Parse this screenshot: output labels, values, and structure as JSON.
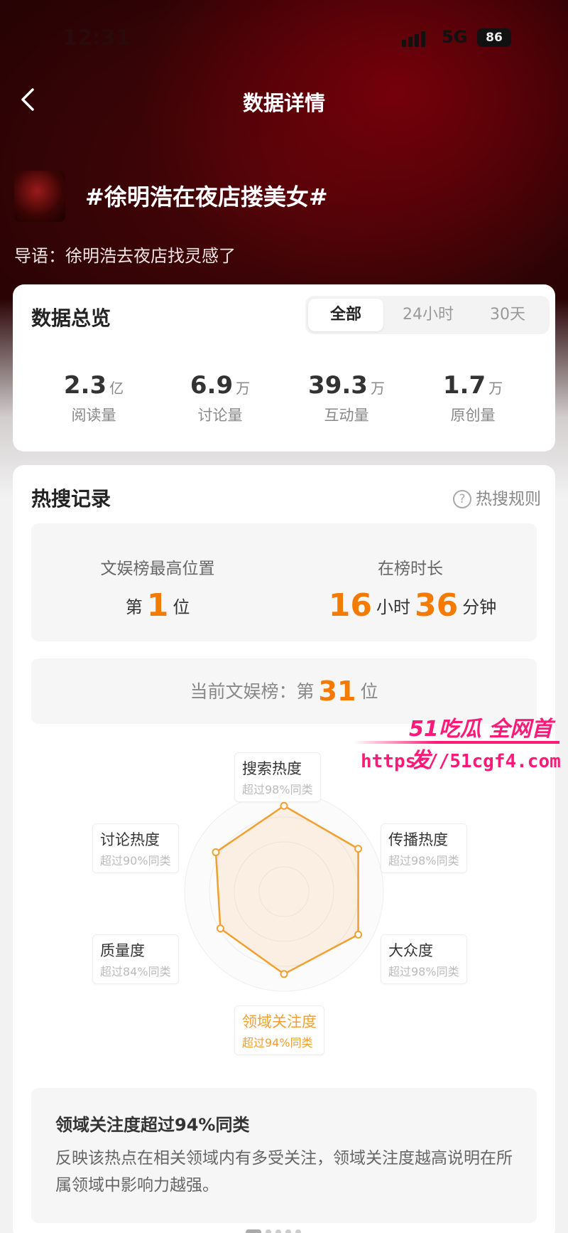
{
  "status_bar": {
    "time": "12:31",
    "network": "5G",
    "battery": "86"
  },
  "nav": {
    "title": "数据详情"
  },
  "topic": {
    "title": "#徐明浩在夜店搂美女#",
    "intro": "导语：徐明浩去夜店找灵感了"
  },
  "overview": {
    "title": "数据总览",
    "tabs": [
      "全部",
      "24小时",
      "30天"
    ],
    "active_tab": "全部",
    "stats": [
      {
        "value": "2.3",
        "unit": "亿",
        "label": "阅读量"
      },
      {
        "value": "6.9",
        "unit": "万",
        "label": "讨论量"
      },
      {
        "value": "39.3",
        "unit": "万",
        "label": "互动量"
      },
      {
        "value": "1.7",
        "unit": "万",
        "label": "原创量"
      }
    ]
  },
  "hot_search": {
    "title": "热搜记录",
    "rules_link": "热搜规则",
    "peak_label": "文娱榜最高位置",
    "peak_prefix": "第",
    "peak_value": "1",
    "peak_suffix": "位",
    "duration_label": "在榜时长",
    "duration_hours": "16",
    "duration_hours_unit": "小时",
    "duration_minutes": "36",
    "duration_minutes_unit": "分钟",
    "current_prefix": "当前文娱榜：第",
    "current_value": "31",
    "current_suffix": "位"
  },
  "radar": {
    "highlight_color": "#f0a030",
    "axes": [
      {
        "name": "搜索热度",
        "sub": "超过98%同类",
        "percent": 98
      },
      {
        "name": "传播热度",
        "sub": "超过98%同类",
        "percent": 98
      },
      {
        "name": "大众度",
        "sub": "超过98%同类",
        "percent": 98
      },
      {
        "name": "领域关注度",
        "sub": "超过94%同类",
        "percent": 94
      },
      {
        "name": "质量度",
        "sub": "超过84%同类",
        "percent": 84
      },
      {
        "name": "讨论热度",
        "sub": "超过90%同类",
        "percent": 90
      }
    ]
  },
  "description": {
    "title": "领域关注度超过94%同类",
    "text": "反映该热点在相关领域内有多受关注，领域关注度越高说明在所属领域中影响力越强。"
  },
  "watermark": {
    "brand": "51吃瓜 全网首发",
    "url": "https://51cgf4.com"
  },
  "colors": {
    "accent": "#f57a00",
    "watermark": "#ff1a7a"
  }
}
